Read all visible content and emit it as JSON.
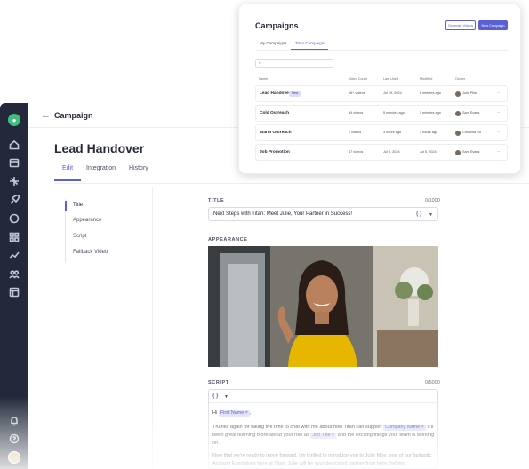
{
  "app": {
    "topbar_title": "Campaign",
    "page_title": "Lead Handover",
    "tabs": [
      {
        "label": "Edit",
        "active": true
      },
      {
        "label": "Integration",
        "active": false
      },
      {
        "label": "History",
        "active": false
      }
    ],
    "left_nav": [
      {
        "label": "Title",
        "active": true
      },
      {
        "label": "Appearance",
        "active": false
      },
      {
        "label": "Script",
        "active": false
      },
      {
        "label": "Fallback Video",
        "active": false
      }
    ],
    "title_field": {
      "label": "TITLE",
      "count": "0/1000",
      "value": "Next Steps with Titan: Meet Julie, Your Partner in Success!",
      "variable_icon": "{ }"
    },
    "appearance_label": "APPEARANCE",
    "script_field": {
      "label": "SCRIPT",
      "count": "0/5000",
      "variable_icon": "{ }",
      "line1_pre": "Hi",
      "line1_chip": "First Name",
      "line1_post": ",",
      "para2_a": "Thanks again for taking the time to chat with me about how Titan can support",
      "para2_chip1": "Company Name",
      "para2_b": "It's been great learning more about your role as",
      "para2_chip2": "Job Title",
      "para2_c": "and the exciting things your team is working on.",
      "para3": "Now that we're ready to move forward, I'm thrilled to introduce you to Julie Moe, one of our fantastic Account Executives here at Titan. Julie will be your dedicated partner from here, helping"
    },
    "chip_close": "×",
    "accent": "#5b5fd6",
    "sidebar_bg": "#23293a",
    "sidebar_icons": [
      "logo-icon",
      "home-icon",
      "calendar-icon",
      "sparkle-icon",
      "rocket-icon",
      "chat-icon",
      "grid-icon",
      "chart-icon",
      "team-icon",
      "layout-icon",
      "bell-icon",
      "help-icon"
    ]
  },
  "campaigns_card": {
    "title": "Campaigns",
    "generate_button": "Generate Videos",
    "new_button": "New Campaign",
    "tabs": [
      {
        "label": "My Campaigns",
        "active": false
      },
      {
        "label": "Titan Campaigns",
        "active": true
      }
    ],
    "columns": [
      "Name",
      "Video Count",
      "Last Used",
      "Modified",
      "Owner"
    ],
    "rows": [
      {
        "name": "Lead Handover",
        "badge": "New",
        "count": "16+ videos",
        "last_used": "Jul 19, 2024",
        "modified": "8 minutes ago",
        "owner": "Julia Pike"
      },
      {
        "name": "Cold Outreach",
        "badge": "",
        "count": "34 videos",
        "last_used": "5 minutes ago",
        "modified": "5 minutes ago",
        "owner": "Sam Evans"
      },
      {
        "name": "Warm Outreach",
        "badge": "",
        "count": "2 videos",
        "last_used": "3 hours ago",
        "modified": "3 hours ago",
        "owner": "Christina Ru"
      },
      {
        "name": "Job Promotion",
        "badge": "",
        "count": "47 videos",
        "last_used": "Jul 5, 2024",
        "modified": "Jul 5, 2024",
        "owner": "Sam Evans"
      }
    ],
    "more_icon": "···"
  }
}
